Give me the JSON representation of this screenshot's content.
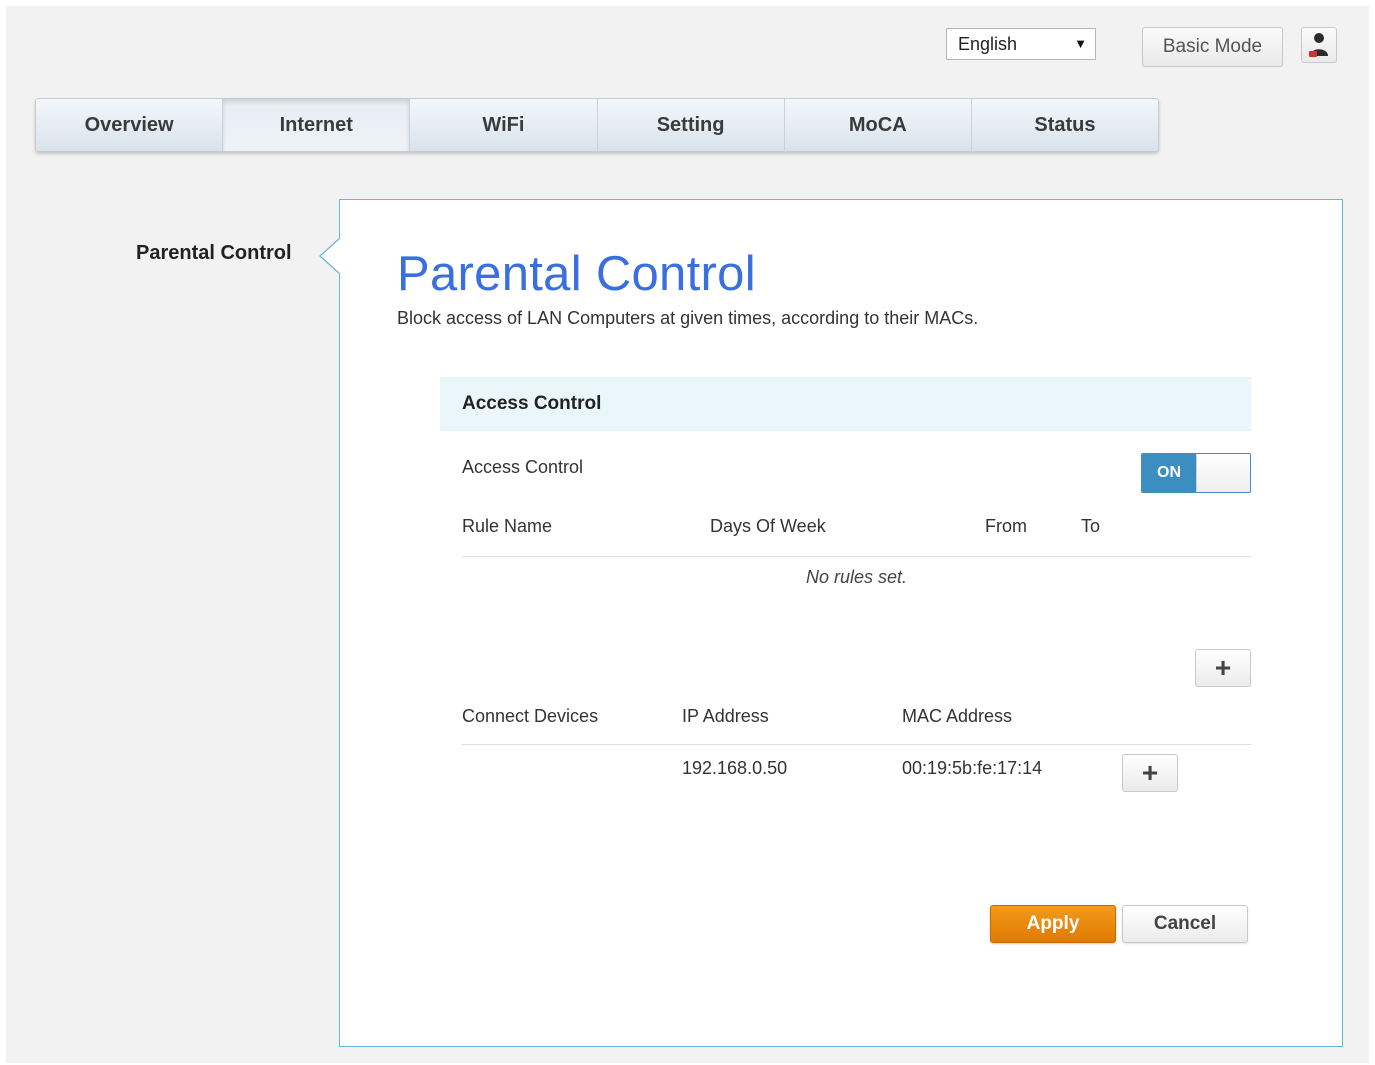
{
  "header": {
    "language": {
      "selected": "English"
    },
    "basic_mode_label": "Basic Mode",
    "user_icon": "user-icon"
  },
  "nav": {
    "tabs": [
      {
        "label": "Overview"
      },
      {
        "label": "Internet",
        "active": true
      },
      {
        "label": "WiFi"
      },
      {
        "label": "Setting"
      },
      {
        "label": "MoCA"
      },
      {
        "label": "Status"
      }
    ]
  },
  "sidebar": {
    "items": [
      {
        "label": "Parental Control",
        "active": true
      }
    ]
  },
  "main": {
    "title": "Parental Control",
    "description": "Block access of LAN Computers at given times, according to their MACs.",
    "section_title": "Access Control",
    "access_control": {
      "label": "Access Control",
      "toggle_state": "ON"
    },
    "rules": {
      "columns": [
        "Rule Name",
        "Days Of Week",
        "From",
        "To"
      ],
      "empty_message": "No rules set.",
      "add_icon": "plus-icon"
    },
    "devices": {
      "columns": [
        "Connect Devices",
        "IP Address",
        "MAC Address"
      ],
      "rows": [
        {
          "name": "",
          "ip": "192.168.0.50",
          "mac": "00:19:5b:fe:17:14"
        }
      ],
      "add_icon": "plus-icon"
    },
    "apply_label": "Apply",
    "cancel_label": "Cancel"
  },
  "colors": {
    "title_blue": "#3a6fe0",
    "panel_border": "#68b6d8",
    "toggle_on": "#3d8ec0",
    "apply_orange": "#e98a10",
    "section_bg": "#eaf6fa"
  }
}
